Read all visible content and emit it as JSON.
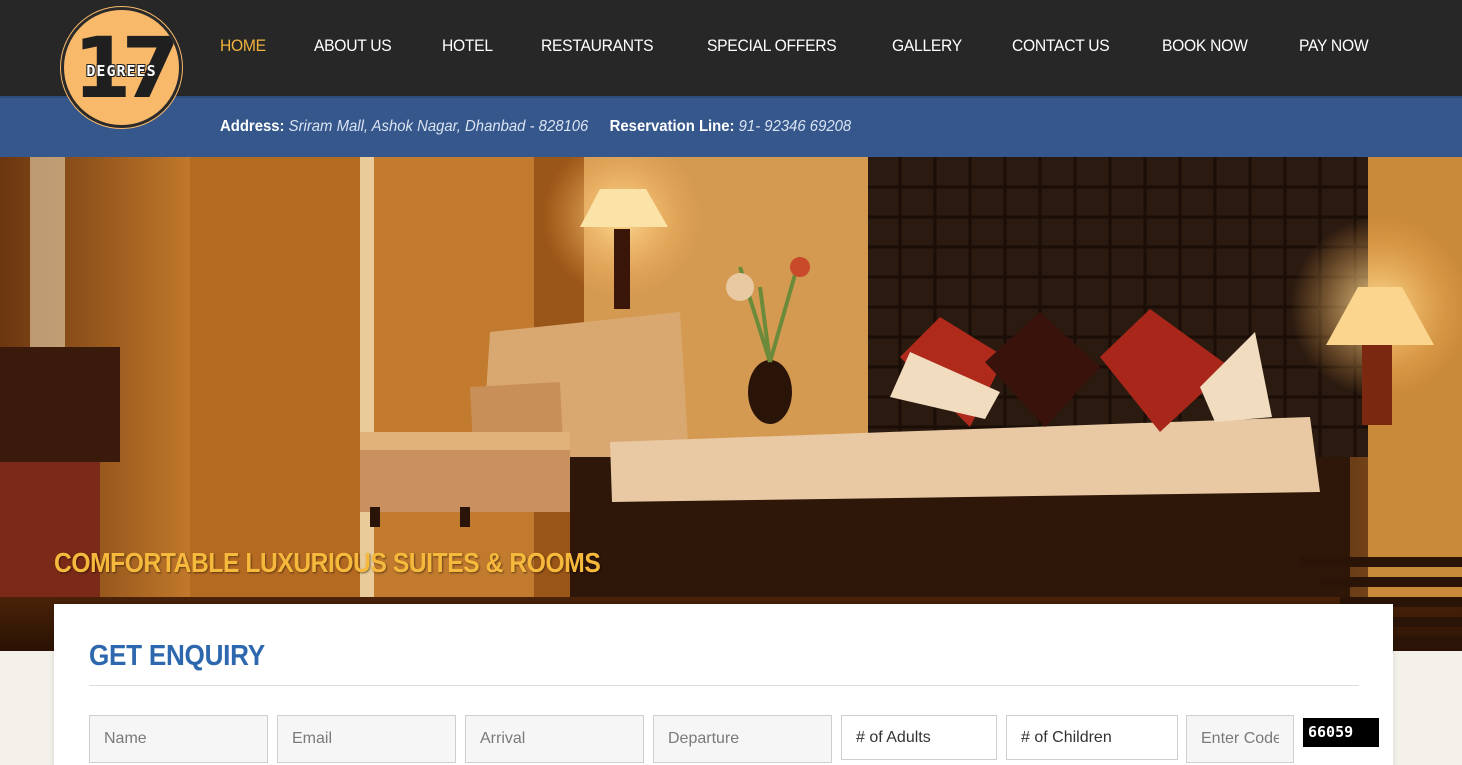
{
  "brand": {
    "logo_number": "17",
    "logo_word": "DEGREES"
  },
  "nav": {
    "items": [
      "HOME",
      "ABOUT US",
      "HOTEL",
      "RESTAURANTS",
      "SPECIAL OFFERS",
      "GALLERY",
      "CONTACT US",
      "BOOK NOW",
      "PAY NOW"
    ],
    "active": "HOME"
  },
  "info": {
    "address_label": "Address:",
    "address_value": "Sriram Mall, Ashok Nagar, Dhanbad - 828106",
    "reservation_label": "Reservation Line:",
    "reservation_value": "91- 92346 69208"
  },
  "hero": {
    "caption": "COMFORTABLE LUXURIOUS SUITES & ROOMS"
  },
  "enquiry": {
    "title": "GET ENQUIRY",
    "name_placeholder": "Name",
    "email_placeholder": "Email",
    "arrival_placeholder": "Arrival",
    "departure_placeholder": "Departure",
    "adults_selected": "# of Adults",
    "children_selected": "# of Children",
    "code_placeholder": "Enter Code",
    "captcha_code": "66059"
  },
  "colors": {
    "topbar": "#272727",
    "addrbar": "#36578c",
    "nav_active": "#f2b33d",
    "caption": "#f6b93b",
    "enquiry_title": "#2d67ae",
    "logo_circle": "#f9b96a"
  }
}
